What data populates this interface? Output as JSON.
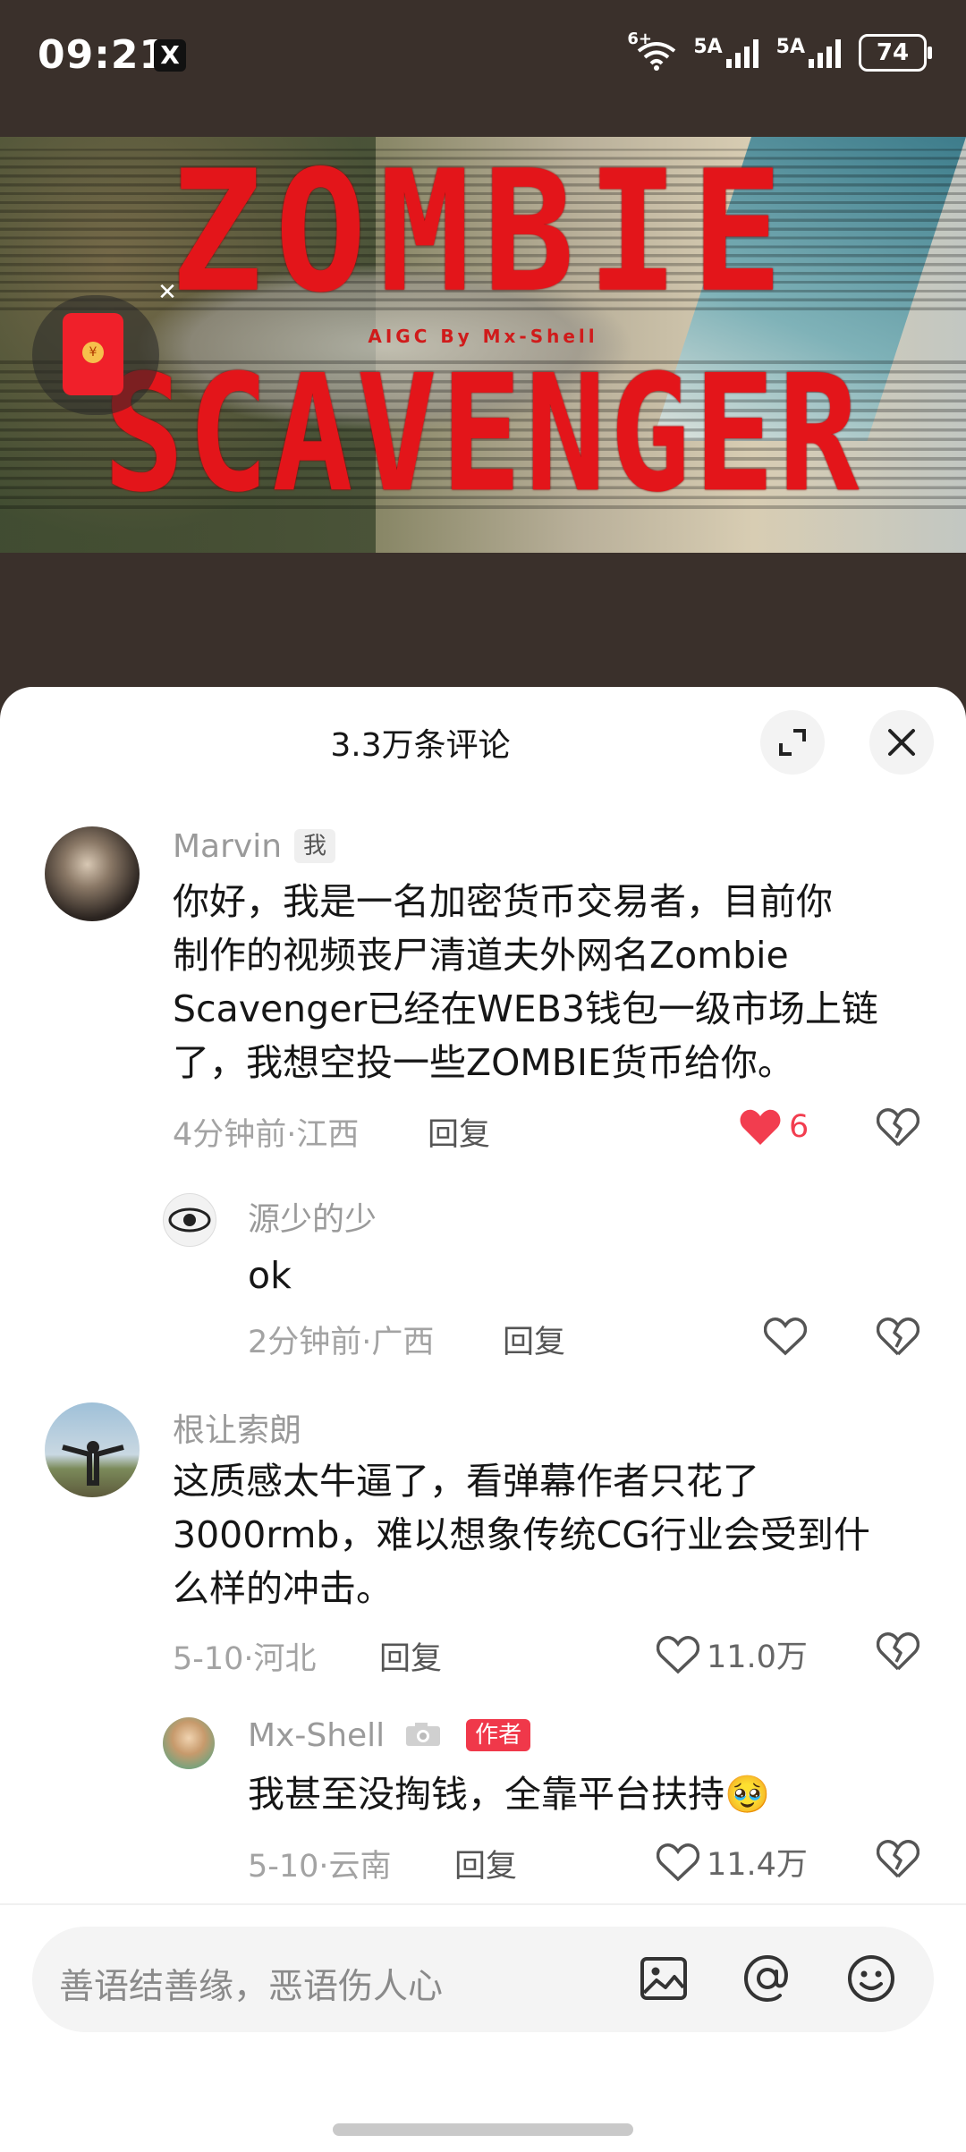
{
  "status_bar": {
    "time": "09:21",
    "app_icon": "X",
    "wifi_label": "6+",
    "sim1_label": "5A",
    "sim2_label": "5A",
    "battery": "74"
  },
  "video": {
    "title_line1": "ZOMBIE",
    "title_line2": "SCAVENGER",
    "subtitle": "AIGC By Mx-Shell"
  },
  "sheet": {
    "title": "3.3万条评论"
  },
  "comments": [
    {
      "author": "Marvin",
      "tag": "我",
      "lines": [
        "你好，我是一名加密货币交易者，目前你",
        "制作的视频丧尸清道夫外网名Zombie",
        "Scavenger已经在WEB3钱包一级市场上链",
        "了，我想空投一些ZOMBIE货币给你。"
      ],
      "time_loc": "4分钟前·江西",
      "reply_label": "回复",
      "likes": "6"
    },
    {
      "author": "源少的少",
      "text": "ok",
      "time_loc": "2分钟前·广西",
      "reply_label": "回复",
      "likes": ""
    },
    {
      "author": "根让索朗",
      "lines": [
        "这质感太牛逼了，看弹幕作者只花了",
        "3000rmb，难以想象传统CG行业会受到什",
        "么样的冲击。"
      ],
      "time_loc": "5-10·河北",
      "reply_label": "回复",
      "likes": "11.0万"
    },
    {
      "author": "Mx-Shell",
      "tag": "作者",
      "text": "我甚至没掏钱，全靠平台扶持",
      "emoji": "🥹",
      "time_loc": "5-10·云南",
      "reply_label": "回复",
      "likes": "11.4万"
    }
  ],
  "input": {
    "placeholder": "善语结善缘，恶语伤人心"
  },
  "colors": {
    "accent": "#f23d4f",
    "author_tag": "#f0384a",
    "title_red": "#e3151a"
  }
}
